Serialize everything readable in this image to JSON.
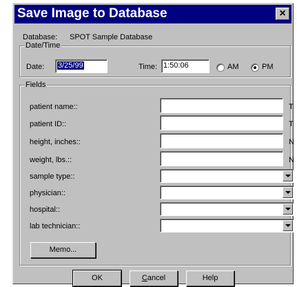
{
  "window": {
    "title": "Save Image to Database",
    "close_label": "×"
  },
  "database": {
    "label": "Database:",
    "value": "SPOT Sample Database"
  },
  "datetime": {
    "group_label": "Date/Time",
    "date_label": "Date:",
    "date_value": "3/25/99",
    "time_label": "Time:",
    "time_value": "1:50:06",
    "am_label": "AM",
    "pm_label": "PM",
    "selected": "PM"
  },
  "fields": {
    "group_label": "Fields",
    "text_fields": [
      {
        "label": "patient name::",
        "value": "",
        "type": "T"
      },
      {
        "label": "patient ID::",
        "value": "",
        "type": "T"
      },
      {
        "label": "height, inches::",
        "value": "",
        "type": "N"
      },
      {
        "label": "weight, lbs.::",
        "value": "",
        "type": "N"
      }
    ],
    "combo_fields": [
      {
        "label": "sample type::",
        "value": ""
      },
      {
        "label": "physician::",
        "value": ""
      },
      {
        "label": "hospital::",
        "value": ""
      },
      {
        "label": "lab technician::",
        "value": ""
      }
    ],
    "memo_label": "Memo..."
  },
  "buttons": {
    "ok": "OK",
    "cancel_hotkey": "C",
    "cancel_rest": "ancel",
    "help": "Help"
  }
}
